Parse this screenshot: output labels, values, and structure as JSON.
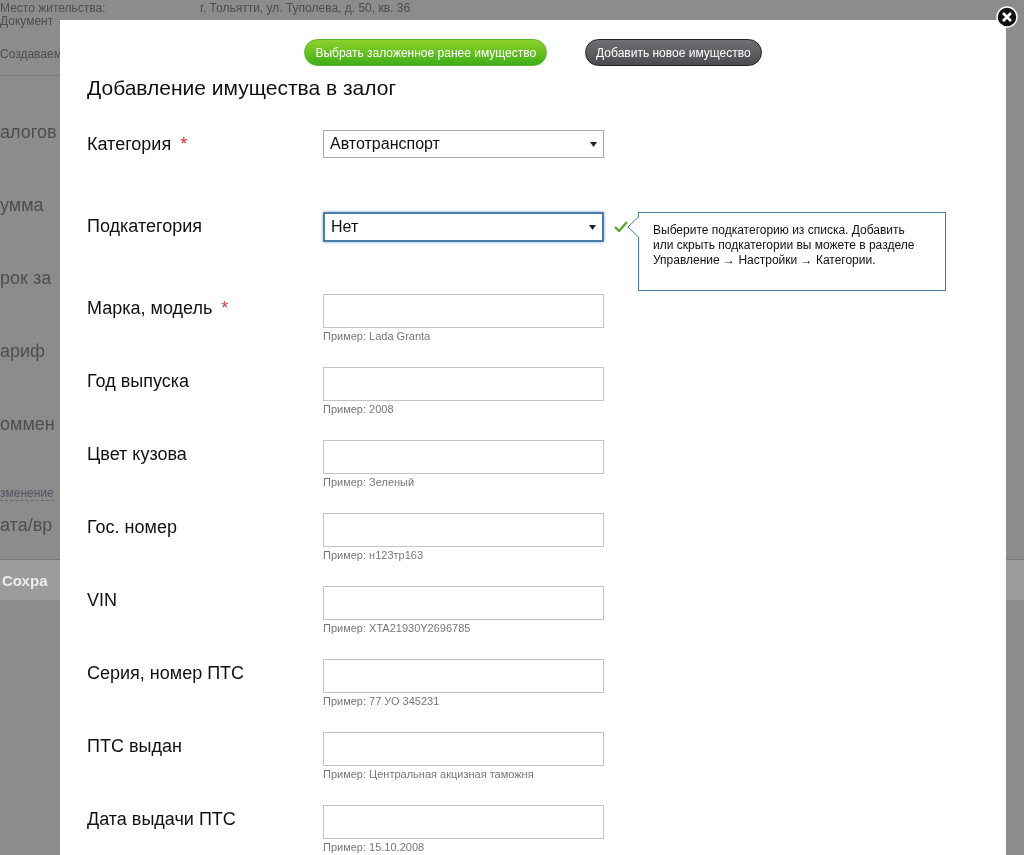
{
  "background_page": {
    "info_rows": [
      {
        "label": "Место жительства:",
        "value": "г. Тольятти, ул. Туполева, д. 50, кв. 36"
      },
      {
        "label": "Документ"
      }
    ],
    "caption": "Создаваем",
    "field_labels": [
      "алогов",
      "умма",
      "рок за",
      "ариф",
      "оммен"
    ],
    "change_link": "зменение",
    "date_label": "ата/вр",
    "save_button": "Сохра"
  },
  "modal": {
    "buttons": [
      {
        "label": "Выбрать заложенное ранее имущество",
        "kind": "primary"
      },
      {
        "label": "Добавить новое имущество",
        "kind": "secondary"
      }
    ],
    "title": "Добавление имущества в залог",
    "fields": [
      {
        "label": "Категория",
        "required_mark": "*",
        "kind": "select",
        "value": "Автотранспорт",
        "focused": false
      },
      {
        "label": "Подкатегория",
        "kind": "select",
        "value": "Нет",
        "focused": true,
        "valid": true,
        "tooltip": "Выберите подкатегорию из списка. Добавить или скрыть подкатегории вы можете в разделе Управление → Настройки → Категории."
      },
      {
        "label": "Марка, модель",
        "required_mark": "*",
        "kind": "text",
        "hint": "Пример: Lada Granta"
      },
      {
        "label": "Год выпуска",
        "kind": "text",
        "hint": "Пример: 2008"
      },
      {
        "label": "Цвет кузова",
        "kind": "text",
        "hint": "Пример: Зеленый"
      },
      {
        "label": "Гос. номер",
        "kind": "text",
        "hint": "Пример: н123тр163"
      },
      {
        "label": "VIN",
        "kind": "text",
        "hint": "Пример: XTA21930Y2696785"
      },
      {
        "label": "Серия, номер ПТС",
        "kind": "text",
        "hint": "Пример: 77 УО 345231"
      },
      {
        "label": "ПТС выдан",
        "kind": "text",
        "hint": "Пример: Центральная акцизная таможня"
      },
      {
        "label": "Дата выдачи ПТС",
        "kind": "text",
        "hint": "Пример: 15.10.2008"
      }
    ]
  }
}
